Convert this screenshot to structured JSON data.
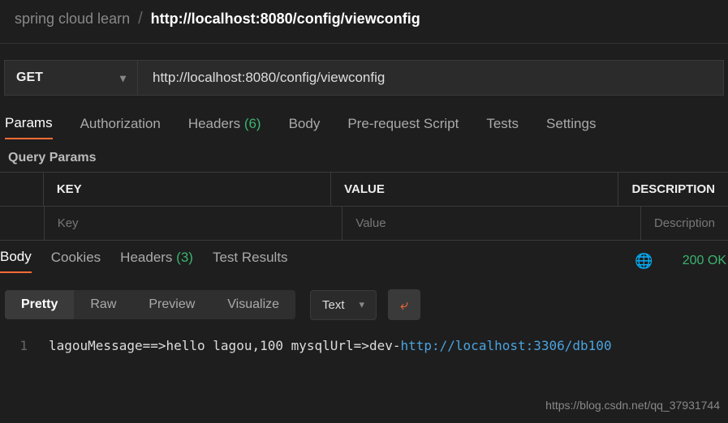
{
  "breadcrumb": {
    "project": "spring cloud learn",
    "sep": "/",
    "title": "http://localhost:8080/config/viewconfig"
  },
  "request": {
    "method": "GET",
    "url": "http://localhost:8080/config/viewconfig"
  },
  "reqTabs": {
    "params": "Params",
    "auth": "Authorization",
    "headers": "Headers",
    "headersCount": "(6)",
    "body": "Body",
    "prereq": "Pre-request Script",
    "tests": "Tests",
    "settings": "Settings"
  },
  "queryParams": {
    "title": "Query Params",
    "headers": {
      "key": "KEY",
      "value": "VALUE",
      "desc": "DESCRIPTION"
    },
    "placeholders": {
      "key": "Key",
      "value": "Value",
      "desc": "Description"
    }
  },
  "respTabs": {
    "body": "Body",
    "cookies": "Cookies",
    "headers": "Headers",
    "headersCount": "(3)",
    "tests": "Test Results",
    "status": "200 OK"
  },
  "view": {
    "pretty": "Pretty",
    "raw": "Raw",
    "preview": "Preview",
    "visualize": "Visualize",
    "type": "Text"
  },
  "responseBody": {
    "lineNo": "1",
    "text": "lagouMessage==>hello lagou,100 mysqlUrl=>dev-",
    "link": "http://localhost:3306/db100"
  },
  "watermark": "https://blog.csdn.net/qq_37931744"
}
